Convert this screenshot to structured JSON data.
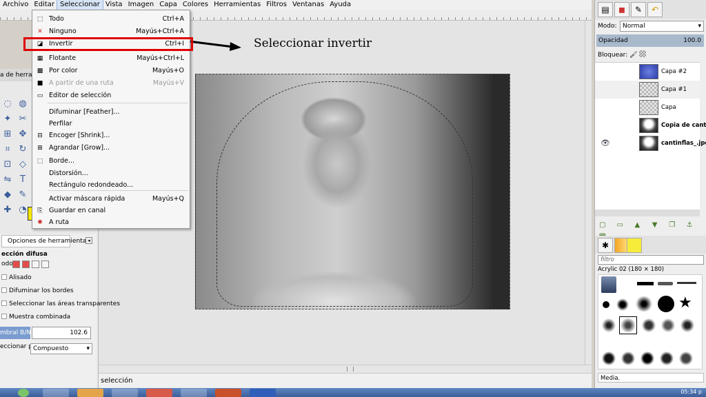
{
  "menubar": {
    "items": [
      "Archivo",
      "Editar",
      "Seleccionar",
      "Vista",
      "Imagen",
      "Capa",
      "Colores",
      "Herramientas",
      "Filtros",
      "Ventanas",
      "Ayuda"
    ],
    "active_index": 2
  },
  "select_menu": {
    "items": [
      {
        "label": "Todo",
        "shortcut": "Ctrl+A",
        "icon": "dotted-rect-icon",
        "disabled": false
      },
      {
        "label": "Ninguno",
        "shortcut": "Mayús+Ctrl+A",
        "icon": "x-icon",
        "disabled": false
      },
      {
        "label": "Invertir",
        "shortcut": "Ctrl+I",
        "icon": "invert-icon",
        "disabled": false
      },
      {
        "label": "Flotante",
        "shortcut": "Mayús+Ctrl+L",
        "icon": "float-icon",
        "disabled": false
      },
      {
        "label": "Por color",
        "shortcut": "Mayús+O",
        "icon": "by-color-icon",
        "disabled": false
      },
      {
        "label": "A partir de una ruta",
        "shortcut": "Mayús+V",
        "icon": "path-icon",
        "disabled": true
      },
      {
        "label": "Editor de selección",
        "shortcut": "",
        "icon": "editor-icon",
        "disabled": false
      },
      {
        "label": "Difuminar [Feather]...",
        "shortcut": "",
        "icon": "",
        "disabled": false
      },
      {
        "label": "Perfilar",
        "shortcut": "",
        "icon": "",
        "disabled": false
      },
      {
        "label": "Encoger [Shrink]...",
        "shortcut": "",
        "icon": "shrink-icon",
        "disabled": false
      },
      {
        "label": "Agrandar [Grow]...",
        "shortcut": "",
        "icon": "grow-icon",
        "disabled": false
      },
      {
        "label": "Borde...",
        "shortcut": "",
        "icon": "border-icon",
        "disabled": false
      },
      {
        "label": "Distorsión...",
        "shortcut": "",
        "icon": "",
        "disabled": false
      },
      {
        "label": "Rectángulo redondeado...",
        "shortcut": "",
        "icon": "",
        "disabled": false
      },
      {
        "label": "Activar máscara rápida",
        "shortcut": "Mayús+Q",
        "icon": "",
        "disabled": false
      },
      {
        "label": "Guardar en canal",
        "shortcut": "",
        "icon": "save-channel-icon",
        "disabled": false
      },
      {
        "label": "A ruta",
        "shortcut": "",
        "icon": "to-path-icon",
        "disabled": false
      }
    ]
  },
  "annotation": {
    "text": "Seleccionar invertir",
    "highlight_color": "#e00000"
  },
  "toolbox": {
    "tab_label": "a de herramientas",
    "tools": [
      "lasso-icon",
      "ellipse-icon",
      "fuzzy-icon",
      "scissors-icon",
      "align-icon",
      "move-icon",
      "crop-icon",
      "rotate-icon",
      "cage-icon",
      "perspective-icon",
      "flip-icon",
      "text-icon",
      "bucket-icon",
      "pencil-icon",
      "heal-icon",
      "dodge-icon"
    ],
    "fg_color": "#f4e600"
  },
  "tool_options": {
    "tab_label": "Opciones de herramienta",
    "title": "ección difusa",
    "mode_label": "odo:",
    "antialias": "Alisado",
    "feather": "Difuminar los bordes",
    "select_transparent": "Seleccionar las áreas transparentes",
    "sample_merged": "Muestra combinada",
    "threshold_label": "mbral B/N",
    "threshold_value": "102.6",
    "select_by_label": "eccionar por:",
    "select_by_value": "Compuesto"
  },
  "status": {
    "text": "selección"
  },
  "layers": {
    "mode_label": "Modo:",
    "mode_value": "Normal",
    "opacity_label": "Opacidad",
    "opacity_value": "100.0",
    "lock_label": "Bloquear:",
    "items": [
      {
        "name": "Capa #2",
        "thumb": "blue",
        "visible": false,
        "bold": false
      },
      {
        "name": "Capa #1",
        "thumb": "checker",
        "visible": false,
        "bold": false
      },
      {
        "name": "Capa",
        "thumb": "checker",
        "visible": false,
        "bold": false
      },
      {
        "name": "Copia de cantinfl",
        "thumb": "bw",
        "visible": false,
        "bold": true
      },
      {
        "name": "cantinflas_.jpeg",
        "thumb": "bw",
        "visible": true,
        "bold": true
      }
    ]
  },
  "brushes": {
    "filter_placeholder": "filtro",
    "current_brush": "Acrylic 02 (180 × 180)",
    "media_label": "Media."
  },
  "taskbar": {
    "clock": "05:34 p"
  }
}
